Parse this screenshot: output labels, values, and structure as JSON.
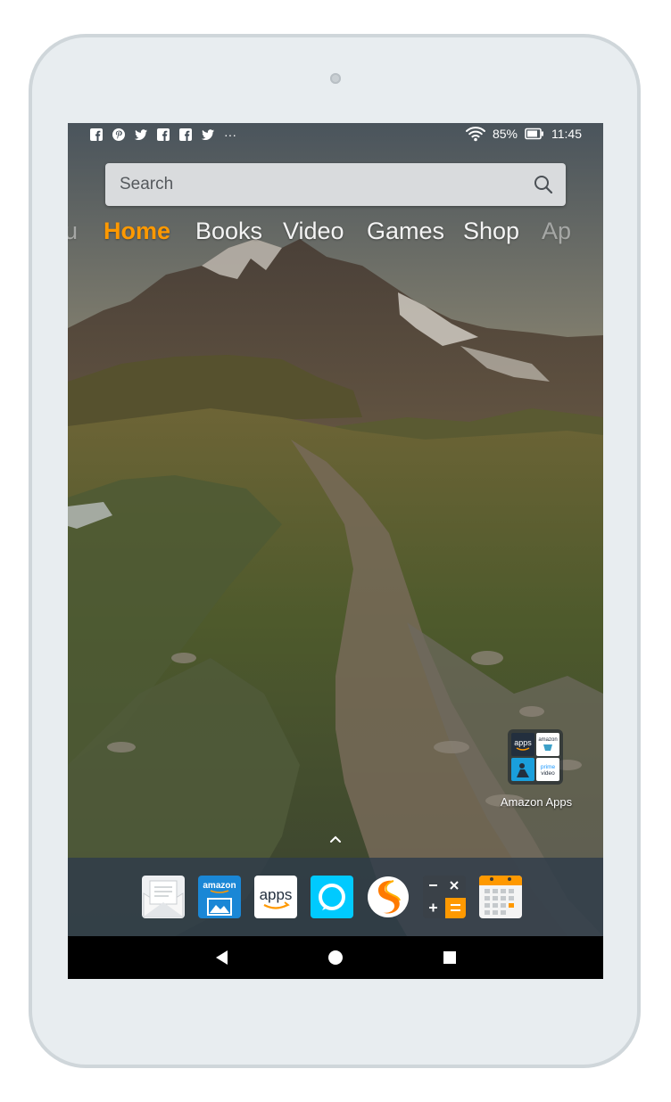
{
  "status_bar": {
    "notification_icons": [
      "facebook-icon",
      "pinterest-icon",
      "twitter-icon",
      "facebook-icon",
      "facebook-icon",
      "twitter-icon"
    ],
    "more": "···",
    "battery_percent": "85%",
    "battery_level": 0.85,
    "time": "11:45"
  },
  "search": {
    "placeholder": "Search"
  },
  "tabs": [
    {
      "label": "u",
      "state": "partial"
    },
    {
      "label": "Home",
      "state": "active"
    },
    {
      "label": "Books"
    },
    {
      "label": "Video"
    },
    {
      "label": "Games"
    },
    {
      "label": "Shop"
    },
    {
      "label": "Ap",
      "state": "partial"
    }
  ],
  "shortcut": {
    "label": "Amazon Apps",
    "tiles": [
      "apps",
      "amazon",
      "kindle",
      "prime video"
    ]
  },
  "dock": {
    "apps": [
      "email-app",
      "amazon-photos-app",
      "appstore-app",
      "alexa-app",
      "silk-browser-app",
      "calculator-app",
      "calendar-app"
    ],
    "photos_text": "amazon",
    "appstore_text": "apps"
  },
  "colors": {
    "accent": "#ff9900",
    "navbar": "#000000",
    "device": "#e8edf0"
  }
}
